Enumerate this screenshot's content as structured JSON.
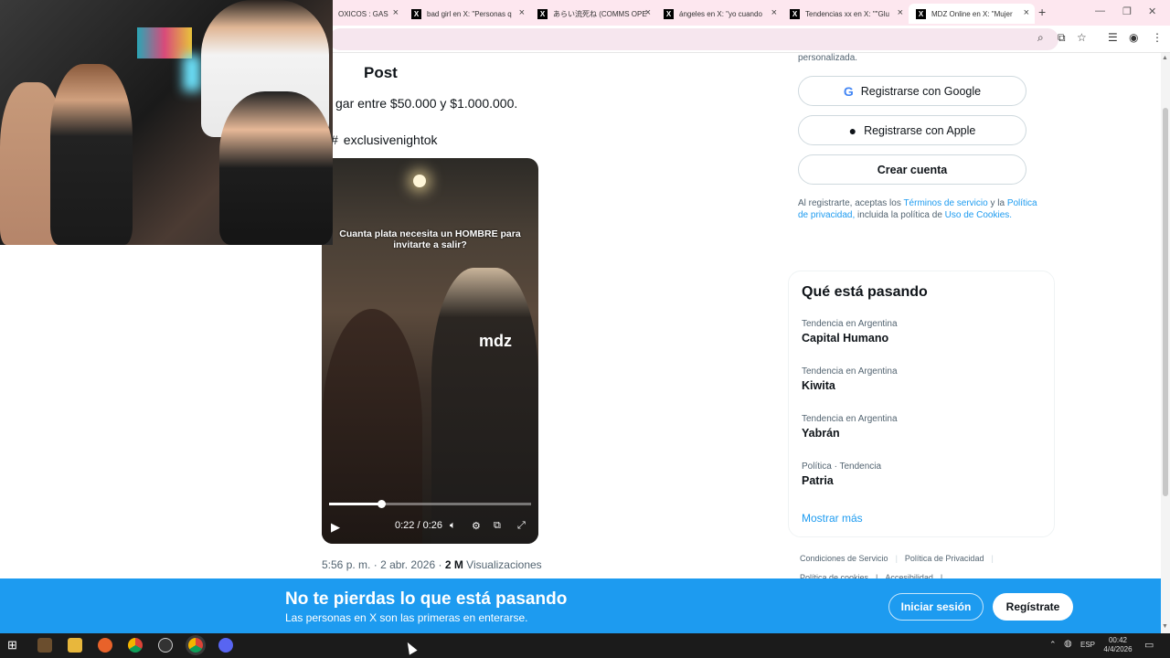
{
  "browser": {
    "tabs": [
      {
        "label": "OXICOS : GAS",
        "active": false
      },
      {
        "label": "bad girl en X: \"Personas q",
        "active": false
      },
      {
        "label": "あらい流死ね (COMMS OPE",
        "active": false
      },
      {
        "label": "ángeles en X: \"yo cuando",
        "active": false
      },
      {
        "label": "Tendencias xx en X: \"\"Glu",
        "active": false
      },
      {
        "label": "MDZ Online en X: \"Mujer",
        "active": true
      }
    ],
    "new_tab": "+",
    "window_controls": {
      "minimize": "—",
      "maximize": "❐",
      "close": "✕"
    }
  },
  "post": {
    "header": "Post",
    "text": "gar entre $50.000 y $1.000.000.",
    "hashtag_icon": "#",
    "hashtag": "exclusivenightok",
    "video": {
      "caption": "Cuanta plata necesita un HOMBRE para invitarte a salir?",
      "logo": "mdz",
      "time": "0:22 / 0:26",
      "progress": 0.26
    },
    "meta": {
      "time": "5:56 p. m.",
      "sep1": "·",
      "date": "2 abr. 2026",
      "sep2": "·",
      "views": "2 M",
      "views_label": "Visualizaciones"
    }
  },
  "signup": {
    "top_note": "personalizada.",
    "google_icon": "G",
    "google_label": "Registrarse con Google",
    "apple_label": "Registrarse con Apple",
    "create_label": "Crear cuenta",
    "legal_prefix": "Al registrarte, aceptas los",
    "legal_terms": "Términos de servicio",
    "legal_and": "y la",
    "legal_privacy": "Política de privacidad,",
    "legal_mid": "incluida la política de",
    "legal_cookies": "Uso de Cookies."
  },
  "trends": {
    "title": "Qué está pasando",
    "items": [
      {
        "context": "Tendencia en Argentina",
        "name": "Capital Humano"
      },
      {
        "context": "Tendencia en Argentina",
        "name": "Kiwita"
      },
      {
        "context": "Tendencia en Argentina",
        "name": "Yabrán"
      },
      {
        "context": "Política · Tendencia",
        "name": "Patria"
      }
    ],
    "show_more": "Mostrar más"
  },
  "footer": {
    "links": [
      "Condiciones de Servicio",
      "Política de Privacidad"
    ],
    "links2": [
      "Política de cookies",
      "Accesibilidad"
    ],
    "sep": "|"
  },
  "banner": {
    "title": "No te pierdas lo que está pasando",
    "subtitle": "Las personas en X son las primeras en enterarse.",
    "login": "Iniciar sesión",
    "signup": "Regístrate"
  },
  "taskbar": {
    "lang": "ESP",
    "time": "00:42",
    "date": "4/4/2026"
  },
  "colors": {
    "accent": "#1d9bf0",
    "tabbar": "#fde7ef"
  }
}
